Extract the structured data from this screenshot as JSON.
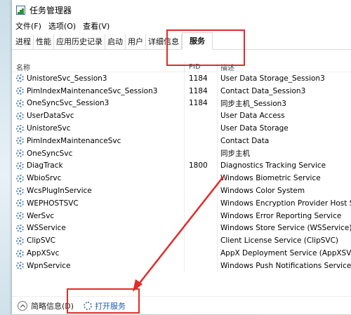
{
  "window": {
    "title": "任务管理器"
  },
  "menu": [
    "文件(F)",
    "选项(O)",
    "查看(V)"
  ],
  "tabs": [
    "进程",
    "性能",
    "应用历史记录",
    "启动",
    "用户",
    "详细信息",
    "服务"
  ],
  "active_tab": "服务",
  "columns": {
    "name": "名称",
    "pid": "PID",
    "desc": "描述"
  },
  "rows": [
    {
      "name": "UnistoreSvc_Session3",
      "pid": "1184",
      "desc": "User Data Storage_Session3"
    },
    {
      "name": "PimIndexMaintenanceSvc_Session3",
      "pid": "1184",
      "desc": "Contact Data_Session3"
    },
    {
      "name": "OneSyncSvc_Session3",
      "pid": "1184",
      "desc": "同步主机_Session3"
    },
    {
      "name": "UserDataSvc",
      "pid": "",
      "desc": "User Data Access"
    },
    {
      "name": "UnistoreSvc",
      "pid": "",
      "desc": "User Data Storage"
    },
    {
      "name": "PimIndexMaintenanceSvc",
      "pid": "",
      "desc": "Contact Data"
    },
    {
      "name": "OneSyncSvc",
      "pid": "",
      "desc": "同步主机"
    },
    {
      "name": "DiagTrack",
      "pid": "1800",
      "desc": "Diagnostics Tracking Service"
    },
    {
      "name": "WbioSrvc",
      "pid": "",
      "desc": "Windows Biometric Service"
    },
    {
      "name": "WcsPlugInService",
      "pid": "",
      "desc": "Windows Color System"
    },
    {
      "name": "WEPHOSTSVC",
      "pid": "",
      "desc": "Windows Encryption Provider Host Se"
    },
    {
      "name": "WerSvc",
      "pid": "",
      "desc": "Windows Error Reporting Service"
    },
    {
      "name": "WSService",
      "pid": "",
      "desc": "Windows Store Service (WSService)"
    },
    {
      "name": "ClipSVC",
      "pid": "",
      "desc": "Client License Service (ClipSVC)"
    },
    {
      "name": "AppXSvc",
      "pid": "",
      "desc": "AppX Deployment Service (AppXSVC)"
    },
    {
      "name": "WpnService",
      "pid": "",
      "desc": "Windows Push Notifications Service"
    }
  ],
  "footer": {
    "fewer_details": "简略信息(D)",
    "open_services": "打开服务"
  },
  "colors": {
    "annotation": "#e22b2b",
    "link": "#1a5cb0"
  }
}
